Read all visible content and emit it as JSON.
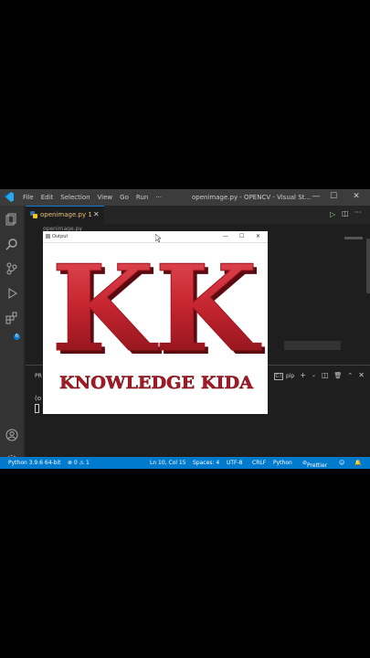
{
  "window": {
    "title": "openimage.py - OPENCV - Visual St..."
  },
  "menu": [
    "File",
    "Edit",
    "Selection",
    "View",
    "Go",
    "Run",
    "···"
  ],
  "tab": {
    "label": "openimage.py",
    "badge": "1",
    "close": "✕"
  },
  "breadcrumb": "openimage.py",
  "output_window": {
    "title": "Output",
    "image": {
      "big_letters": "KK",
      "tagline": "KNOWLEDGE KIDA"
    }
  },
  "panel": {
    "tab": "PR",
    "terminal_label": "pip",
    "line1": "(o"
  },
  "status": {
    "python": "Python 3.9.6 64-bit",
    "problems": "⊗ 0 ⚠ 1",
    "cursor": "Ln 10, Col 15",
    "spaces": "Spaces: 4",
    "encoding": "UTF-8",
    "eol": "CRLF",
    "language": "Python",
    "prettier": "Prettier"
  },
  "colors": {
    "accent": "#007acc",
    "logo_red": "#c4242e"
  }
}
